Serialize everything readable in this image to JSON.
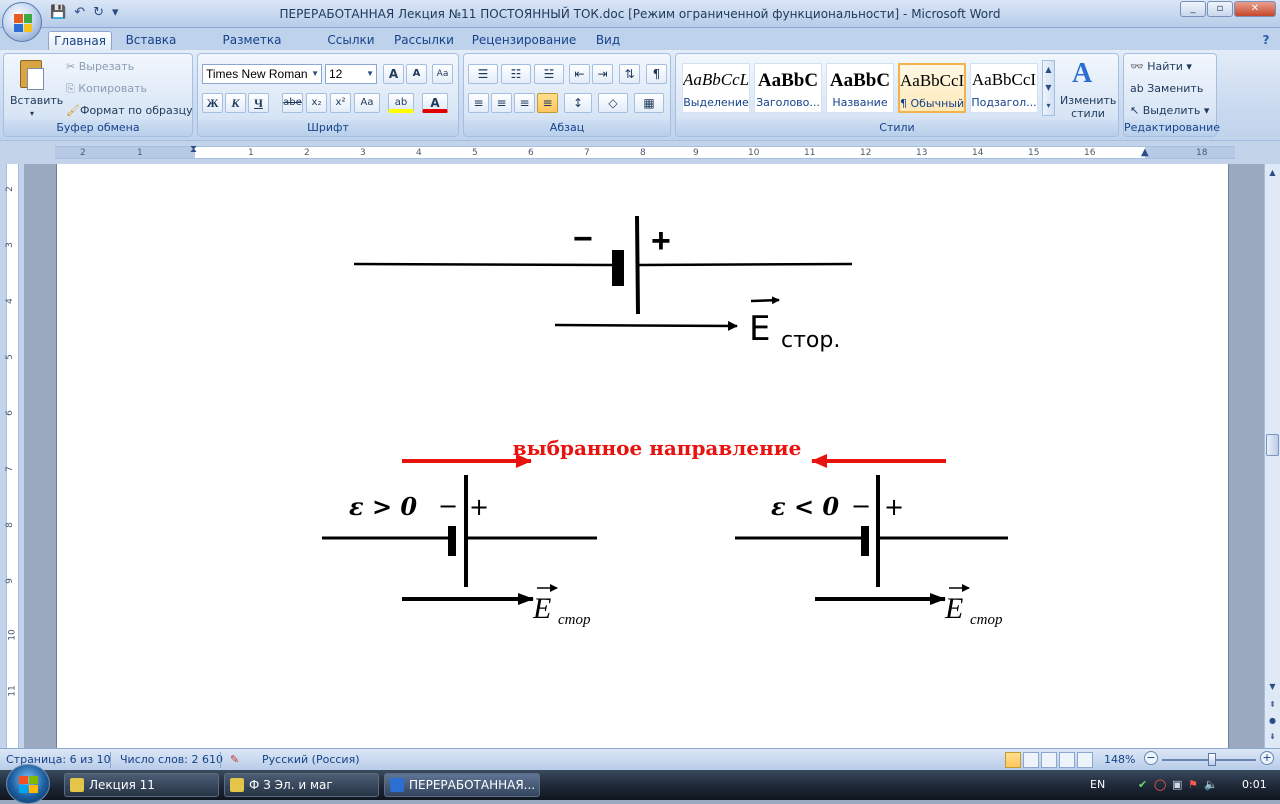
{
  "window": {
    "title": "ПЕРЕРАБОТАННАЯ Лекция №11 ПОСТОЯННЫЙ ТОК.doc [Режим ограниченной функциональности] - Microsoft Word",
    "min": "_",
    "max": "▫",
    "close": "✕"
  },
  "qat": {
    "save": "💾",
    "undo": "↶",
    "redo": "↻",
    "more": "▾"
  },
  "tabs": [
    "Главная",
    "Вставка",
    "Разметка страницы",
    "Ссылки",
    "Рассылки",
    "Рецензирование",
    "Вид"
  ],
  "help": "?",
  "clipboard": {
    "paste": "Вставить",
    "cut": "Вырезать",
    "copy": "Копировать",
    "format_painter": "Формат по образцу",
    "label": "Буфер обмена"
  },
  "font": {
    "name": "Times New Roman",
    "size": "12",
    "grow": "A",
    "shrink": "A",
    "clear": "Aa",
    "bold": "Ж",
    "italic": "К",
    "underline": "Ч",
    "strike": "abe",
    "sub": "x₂",
    "sup": "x²",
    "case": "Aa",
    "highlight": "ab",
    "color": "A",
    "label": "Шрифт"
  },
  "paragraph": {
    "bullets": "☰",
    "numbering": "☷",
    "multilevel": "☱",
    "dec_indent": "⇤",
    "inc_indent": "⇥",
    "sort": "⇅",
    "show_marks": "¶",
    "align_left": "≡",
    "align_center": "≡",
    "align_right": "≡",
    "justify": "≡",
    "spacing": "↕",
    "shading": "◇",
    "borders": "▦",
    "label": "Абзац"
  },
  "styles": {
    "tiles": [
      {
        "preview": "AaBbCcL",
        "name": "Выделение"
      },
      {
        "preview": "AaBbC",
        "name": "Заголово..."
      },
      {
        "preview": "AaBbC",
        "name": "Название"
      },
      {
        "preview": "AaBbCcI",
        "name": "¶ Обычный"
      },
      {
        "preview": "AaBbCcI",
        "name": "Подзагол..."
      }
    ],
    "change": "Изменить стили",
    "change_icon": "A",
    "label": "Стили"
  },
  "editing": {
    "find": "Найти",
    "replace": "Заменить",
    "select": "Выделить",
    "label": "Редактирование"
  },
  "ruler": {
    "ticks": [
      "2",
      "1",
      "1",
      "2",
      "3",
      "4",
      "5",
      "6",
      "7",
      "8",
      "9",
      "10",
      "11",
      "12",
      "13",
      "14",
      "15",
      "16",
      "18"
    ],
    "vticks": [
      "2",
      "3",
      "4",
      "5",
      "6",
      "7",
      "8",
      "9",
      "10",
      "11"
    ],
    "tab_selector": "L"
  },
  "diagram_top": {
    "minus": "−",
    "plus": "+",
    "vector": "E",
    "subscript": "стор."
  },
  "diagram_bottom": {
    "heading": "выбранное направление",
    "left": {
      "condition": "ε > 0",
      "minus": "−",
      "plus": "+",
      "vector": "E",
      "subscript": "стор"
    },
    "right": {
      "condition": "ε < 0",
      "minus": "−",
      "plus": "+",
      "vector": "E",
      "subscript": "стор"
    },
    "red": "#e8120f"
  },
  "status": {
    "page": "Страница: 6 из 10",
    "words": "Число слов: 2 610",
    "proofing_icon": "✎",
    "language": "Русский (Россия)",
    "zoom": "148%",
    "zoom_out": "−",
    "zoom_in": "+"
  },
  "taskbar": {
    "items": [
      "Лекция 11",
      "Ф З Эл. и маг",
      "ПЕРЕРАБОТАННАЯ..."
    ],
    "lang": "EN",
    "clock": "0:01"
  }
}
